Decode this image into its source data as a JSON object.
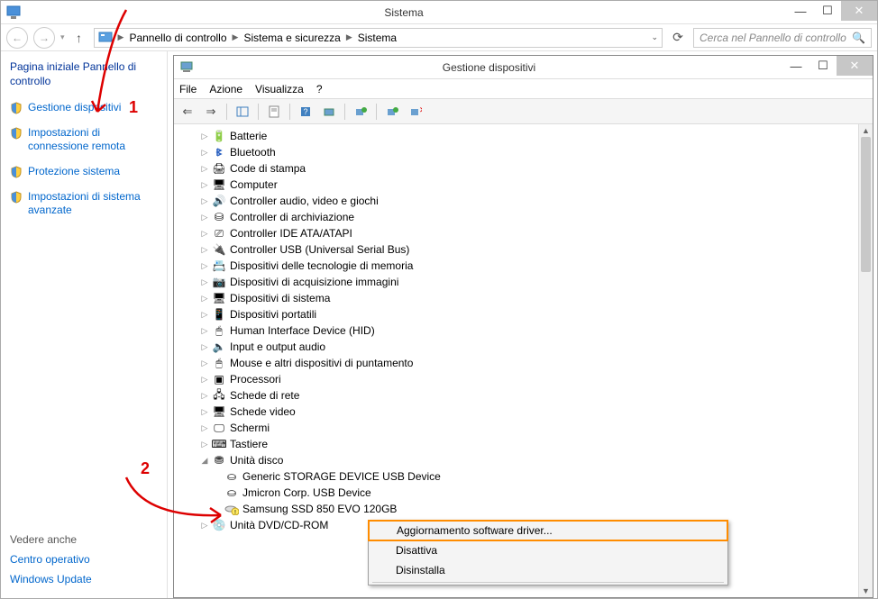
{
  "outer": {
    "title": "Sistema",
    "breadcrumb": {
      "items": [
        "Pannello di controllo",
        "Sistema e sicurezza",
        "Sistema"
      ]
    },
    "search_placeholder": "Cerca nel Pannello di controllo"
  },
  "left": {
    "heading": "Pagina iniziale Pannello di controllo",
    "links": [
      "Gestione dispositivi",
      "Impostazioni di connessione remota",
      "Protezione sistema",
      "Impostazioni di sistema avanzate"
    ],
    "see_also_heading": "Vedere anche",
    "see_also": [
      "Centro operativo",
      "Windows Update"
    ]
  },
  "inner": {
    "title": "Gestione dispositivi",
    "menu": [
      "File",
      "Azione",
      "Visualizza",
      "?"
    ],
    "tree": {
      "categories": [
        {
          "label": "Batterie",
          "icon": "battery"
        },
        {
          "label": "Bluetooth",
          "icon": "bluetooth"
        },
        {
          "label": "Code di stampa",
          "icon": "printer"
        },
        {
          "label": "Computer",
          "icon": "computer"
        },
        {
          "label": "Controller audio, video e giochi",
          "icon": "sound"
        },
        {
          "label": "Controller di archiviazione",
          "icon": "storage"
        },
        {
          "label": "Controller IDE ATA/ATAPI",
          "icon": "ide"
        },
        {
          "label": "Controller USB (Universal Serial Bus)",
          "icon": "usb"
        },
        {
          "label": "Dispositivi delle tecnologie di memoria",
          "icon": "memory"
        },
        {
          "label": "Dispositivi di acquisizione immagini",
          "icon": "camera"
        },
        {
          "label": "Dispositivi di sistema",
          "icon": "system"
        },
        {
          "label": "Dispositivi portatili",
          "icon": "portable"
        },
        {
          "label": "Human Interface Device (HID)",
          "icon": "hid"
        },
        {
          "label": "Input e output audio",
          "icon": "audio"
        },
        {
          "label": "Mouse e altri dispositivi di puntamento",
          "icon": "mouse"
        },
        {
          "label": "Processori",
          "icon": "cpu"
        },
        {
          "label": "Schede di rete",
          "icon": "network"
        },
        {
          "label": "Schede video",
          "icon": "display"
        },
        {
          "label": "Schermi",
          "icon": "monitor"
        },
        {
          "label": "Tastiere",
          "icon": "keyboard"
        }
      ],
      "expanded_category": {
        "label": "Unità disco",
        "icon": "disk"
      },
      "expanded_children": [
        "Generic STORAGE DEVICE USB Device",
        "Jmicron Corp. USB Device",
        "Samsung SSD 850 EVO 120GB"
      ],
      "last_category": {
        "label": "Unità DVD/CD-ROM",
        "icon": "dvd"
      }
    }
  },
  "context_menu": {
    "items": [
      "Aggiornamento software driver...",
      "Disattiva",
      "Disinstalla"
    ],
    "highlight_index": 0
  },
  "annotations": {
    "num1": "1",
    "num2": "2"
  }
}
